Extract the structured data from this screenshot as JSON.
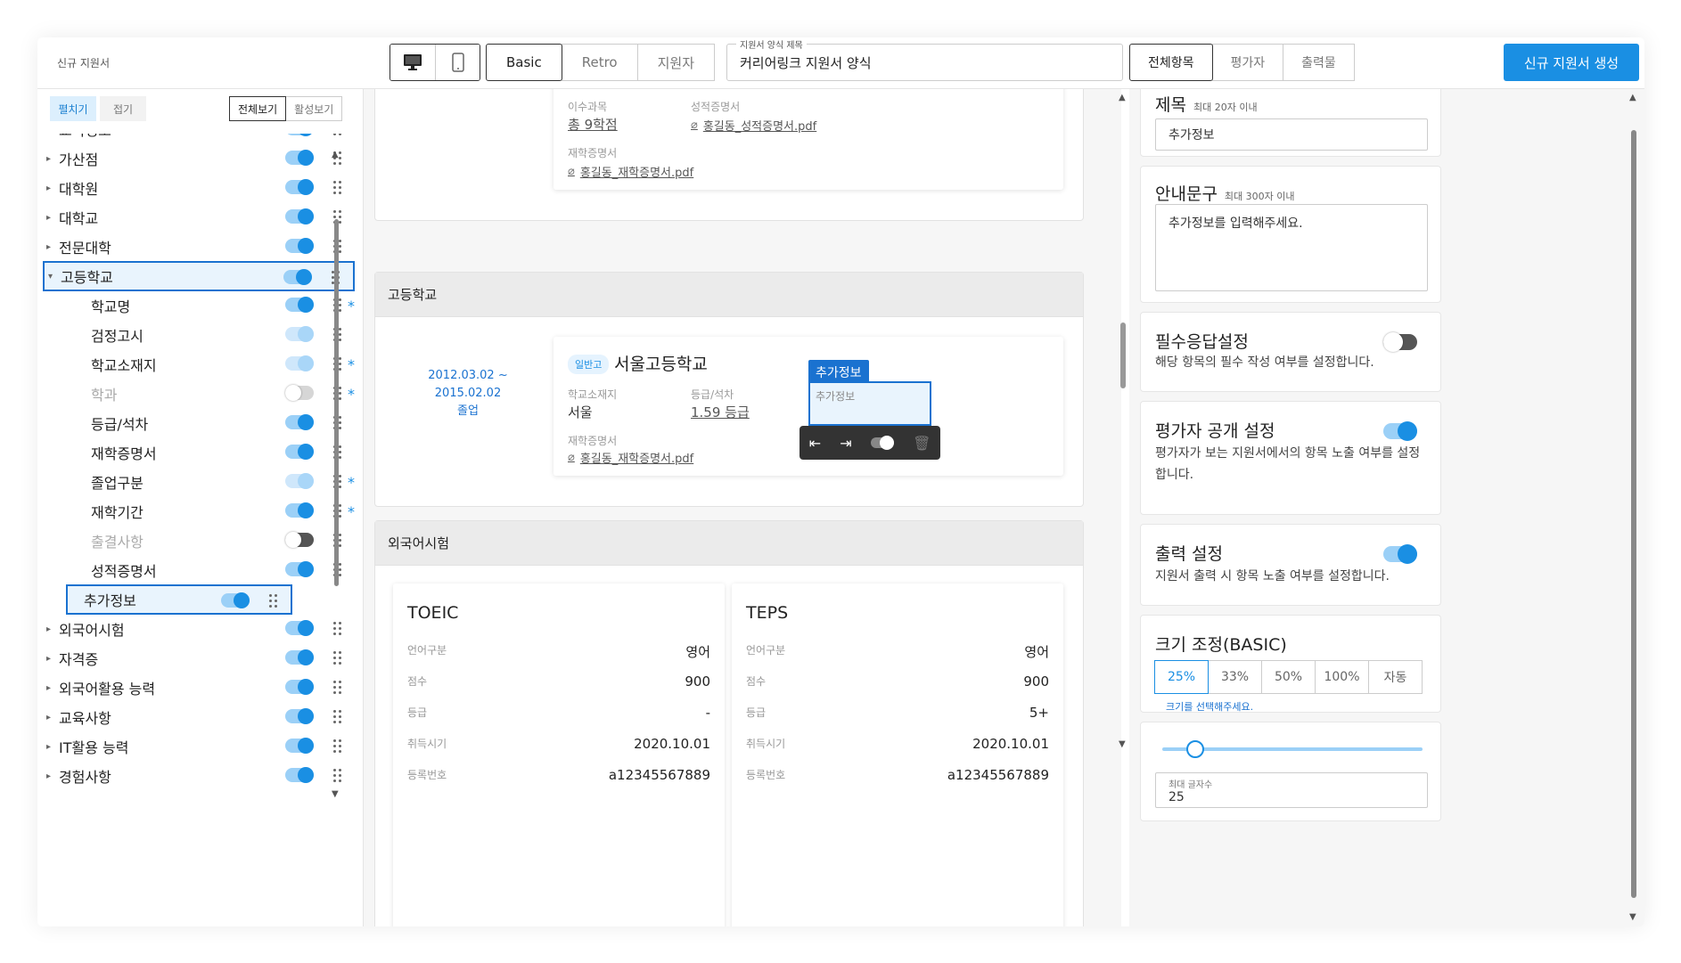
{
  "header": {
    "app_title": "신규 지원서",
    "device_icons": [
      "desktop-icon",
      "mobile-icon"
    ],
    "templates": [
      "Basic",
      "Retro",
      "지원자"
    ],
    "template_active": "Basic",
    "title_field_label": "지원서 양식 제목",
    "title_field_value": "커리어링크 지원서 양식",
    "views": [
      "전체항목",
      "평가자",
      "출력물"
    ],
    "view_active": "전체항목",
    "create_button": "신규 지원서 생성"
  },
  "sidebar": {
    "tabs": [
      "펼치기",
      "접기"
    ],
    "tab_active": "펼치기",
    "filters": [
      "전체보기",
      "활성보기"
    ],
    "filter_active": "전체보기",
    "items": [
      {
        "label": "교육정보",
        "required": false,
        "toggle": "on",
        "child": false,
        "expanded": false,
        "dim": false,
        "selected": false
      },
      {
        "label": "가산점",
        "required": false,
        "toggle": "on",
        "child": false,
        "expanded": false,
        "dim": false,
        "selected": false
      },
      {
        "label": "대학원",
        "required": false,
        "toggle": "on",
        "child": false,
        "expanded": false,
        "dim": false,
        "selected": false
      },
      {
        "label": "대학교",
        "required": false,
        "toggle": "on",
        "child": false,
        "expanded": false,
        "dim": false,
        "selected": false
      },
      {
        "label": "전문대학",
        "required": false,
        "toggle": "on",
        "child": false,
        "expanded": false,
        "dim": false,
        "selected": false
      },
      {
        "label": "고등학교",
        "required": false,
        "toggle": "on",
        "child": false,
        "expanded": true,
        "dim": false,
        "selected": true
      },
      {
        "label": "학교명",
        "required": true,
        "toggle": "on",
        "child": true,
        "dim": false,
        "selected": false
      },
      {
        "label": "검정고시",
        "required": false,
        "toggle": "light",
        "child": true,
        "dim": false,
        "selected": false
      },
      {
        "label": "학교소재지",
        "required": true,
        "toggle": "light",
        "child": true,
        "dim": false,
        "selected": false
      },
      {
        "label": "학과",
        "required": true,
        "toggle": "off",
        "child": true,
        "dim": true,
        "selected": false
      },
      {
        "label": "등급/석차",
        "required": false,
        "toggle": "on",
        "child": true,
        "dim": false,
        "selected": false
      },
      {
        "label": "재학증명서",
        "required": false,
        "toggle": "on",
        "child": true,
        "dim": false,
        "selected": false
      },
      {
        "label": "졸업구분",
        "required": true,
        "toggle": "light",
        "child": true,
        "dim": false,
        "selected": false
      },
      {
        "label": "재학기간",
        "required": true,
        "toggle": "on",
        "child": true,
        "dim": false,
        "selected": false
      },
      {
        "label": "출결사항",
        "required": false,
        "toggle": "half",
        "child": true,
        "dim": true,
        "selected": false
      },
      {
        "label": "성적증명서",
        "required": false,
        "toggle": "on",
        "child": true,
        "dim": false,
        "selected": false
      },
      {
        "label": "추가정보",
        "required": false,
        "toggle": "on",
        "child": true,
        "dim": false,
        "selected": true
      },
      {
        "label": "외국어시험",
        "required": false,
        "toggle": "on",
        "child": false,
        "expanded": false,
        "dim": false,
        "selected": false
      },
      {
        "label": "자격증",
        "required": false,
        "toggle": "on",
        "child": false,
        "expanded": false,
        "dim": false,
        "selected": false
      },
      {
        "label": "외국어활용 능력",
        "required": false,
        "toggle": "on",
        "child": false,
        "expanded": false,
        "dim": false,
        "selected": false
      },
      {
        "label": "교육사항",
        "required": false,
        "toggle": "on",
        "child": false,
        "expanded": false,
        "dim": false,
        "selected": false
      },
      {
        "label": "IT활용 능력",
        "required": false,
        "toggle": "on",
        "child": false,
        "expanded": false,
        "dim": false,
        "selected": false
      },
      {
        "label": "경험사항",
        "required": false,
        "toggle": "on",
        "child": false,
        "expanded": false,
        "dim": false,
        "selected": false
      }
    ]
  },
  "main": {
    "top_card": {
      "credits_label": "이수과목",
      "credits_value": "총 9학점",
      "transcript_label": "성적증명서",
      "transcript_file": "홍길동_성적증명서.pdf",
      "enroll_label": "재학증명서",
      "enroll_file": "홍길동_재학증명서.pdf"
    },
    "highschool": {
      "section_title": "고등학교",
      "period": "2012.03.02 ~ 2015.02.02",
      "status": "졸업",
      "badge": "일반고",
      "school_name": "서울고등학교",
      "location_label": "학교소재지",
      "location_value": "서울",
      "grade_label": "등급/석차",
      "grade_value": "1.59 등급",
      "enroll_label": "재학증명서",
      "enroll_file": "홍길동_재학증명서.pdf",
      "extra_tag": "추가정보",
      "extra_placeholder": "추가정보"
    },
    "language": {
      "section_title": "외국어시험",
      "exams": [
        {
          "name": "TOEIC",
          "rows": [
            [
              "언어구분",
              "영어"
            ],
            [
              "점수",
              "900"
            ],
            [
              "등급",
              "-"
            ],
            [
              "취득시기",
              "2020.10.01"
            ],
            [
              "등록번호",
              "a12345567889"
            ]
          ]
        },
        {
          "name": "TEPS",
          "rows": [
            [
              "언어구분",
              "영어"
            ],
            [
              "점수",
              "900"
            ],
            [
              "등급",
              "5+"
            ],
            [
              "취득시기",
              "2020.10.01"
            ],
            [
              "등록번호",
              "a12345567889"
            ]
          ]
        }
      ]
    }
  },
  "right": {
    "title_label": "제목",
    "title_hint": "최대 20자 이내",
    "title_value": "추가정보",
    "guide_label": "안내문구",
    "guide_hint": "최대 300자 이내",
    "guide_value": "추가정보를 입력해주세요.",
    "required_title": "필수응답설정",
    "required_desc": "해당 항목의 필수 작성 여부를 설정합니다.",
    "required_on": false,
    "evaluator_title": "평가자 공개 설정",
    "evaluator_desc": "평가자가 보는 지원서에서의 항목 노출 여부를 설정합니다.",
    "evaluator_on": true,
    "print_title": "출력 설정",
    "print_desc": "지원서 출력 시 항목 노출 여부를 설정합니다.",
    "print_on": true,
    "size_title": "크기 조정(BASIC)",
    "sizes": [
      "25%",
      "33%",
      "50%",
      "100%",
      "자동"
    ],
    "size_active": "25%",
    "size_hint": "크기를 선택해주세요.",
    "max_chars_label": "최대 글자수",
    "max_chars_value": "25",
    "max_chars_slider": 0.1
  },
  "colors": {
    "accent": "#1a8fe3",
    "selection": "#1a72d0"
  }
}
